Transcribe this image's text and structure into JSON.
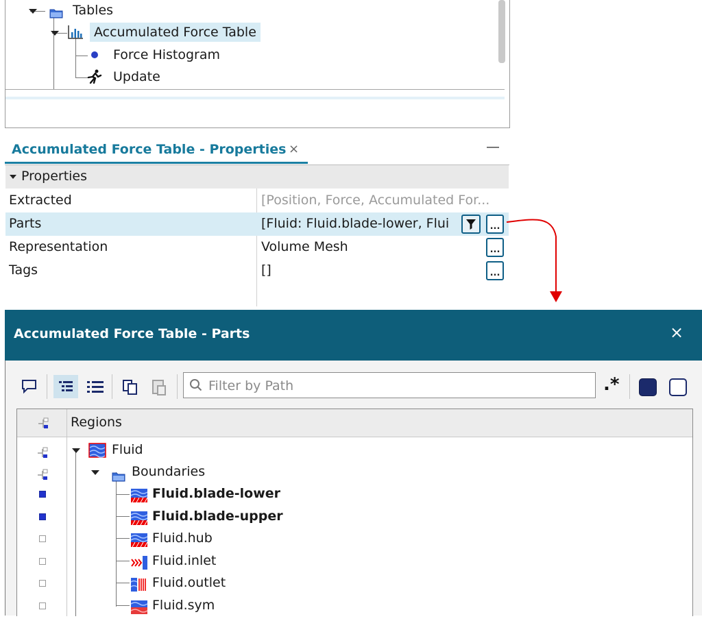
{
  "tree": {
    "items": [
      {
        "label": "Tables",
        "icon": "folder-icon"
      },
      {
        "label": "Accumulated Force Table",
        "icon": "bar-chart-icon",
        "selected": true
      },
      {
        "label": "Force Histogram",
        "icon": "dot-icon"
      },
      {
        "label": "Update",
        "icon": "running-man-icon"
      }
    ]
  },
  "properties": {
    "tab_title": "Accumulated Force Table - Properties",
    "tab_close": "×",
    "group": "Properties",
    "rows": [
      {
        "name": "Extracted",
        "value": "[Position, Force, Accumulated For..."
      },
      {
        "name": "Parts",
        "value": "[Fluid: Fluid.blade-lower, Flui"
      },
      {
        "name": "Representation",
        "value": "Volume Mesh"
      },
      {
        "name": "Tags",
        "value": "[]"
      }
    ],
    "ellipsis": "..."
  },
  "dialog": {
    "title": "Accumulated Force Table - Parts",
    "close": "×",
    "filter_placeholder": "Filter by Path",
    "regex_label": ".*",
    "column_header": "Regions",
    "rows": [
      {
        "label": "Fluid",
        "bold": false,
        "checked": "partial"
      },
      {
        "label": "Boundaries",
        "bold": false,
        "checked": "partial"
      },
      {
        "label": "Fluid.blade-lower",
        "bold": true,
        "checked": "on"
      },
      {
        "label": "Fluid.blade-upper",
        "bold": true,
        "checked": "on"
      },
      {
        "label": "Fluid.hub",
        "bold": false,
        "checked": "off"
      },
      {
        "label": "Fluid.inlet",
        "bold": false,
        "checked": "off"
      },
      {
        "label": "Fluid.outlet",
        "bold": false,
        "checked": "off"
      },
      {
        "label": "Fluid.sym",
        "bold": false,
        "checked": "off"
      }
    ]
  },
  "colors": {
    "accent": "#0e5e7a",
    "selection": "#d7ecf5",
    "tab_text": "#177a9c",
    "connector_arrow": "#e00000"
  }
}
